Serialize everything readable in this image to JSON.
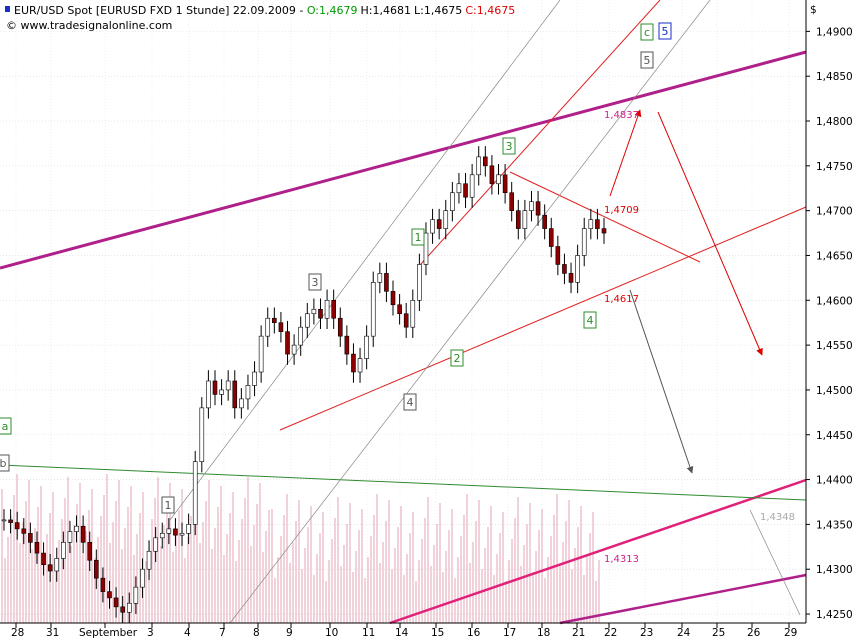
{
  "header": {
    "title": "EUR/USD Spot [EURUSD FXD  1 Stunde] 22.09.2009 - ",
    "open": "O:1,4679",
    "high": "H:1,4681",
    "low": "L:1,4675",
    "close": "C:1,4675",
    "source": "www.tradesignalonline.com",
    "currency_symbol": "$"
  },
  "colors": {
    "up_open": "#00aa00",
    "close_red": "#e00000",
    "candle": "#000000",
    "candle_body_down": "#8b0000",
    "magenta_channel": "#b0208a",
    "pink_channel": "#e0207a",
    "red_channel": "#e02020",
    "green_line": "#2e8b2e",
    "gray_line": "#888888",
    "arrow_red": "#e00000",
    "arrow_gray": "#555555",
    "wave_green": "#2e8b2e",
    "wave_gray": "#555555",
    "wave_blue": "#1a2ec8",
    "volume": "#e8b4c0"
  },
  "chart_data": {
    "type": "candlestick",
    "y_axis": {
      "min": 1.424,
      "max": 1.4935,
      "ticks": [
        "1,4250",
        "1,4300",
        "1,4350",
        "1,4400",
        "1,4450",
        "1,4500",
        "1,4550",
        "1,4600",
        "1,4650",
        "1,4700",
        "1,4750",
        "1,4800",
        "1,4850",
        "1,4900"
      ]
    },
    "x_axis": {
      "ticks": [
        "28",
        "31",
        "September",
        "3",
        "4",
        "7",
        "8",
        "9",
        "10",
        "11",
        "14",
        "15",
        "16",
        "17",
        "18",
        "21",
        "22",
        "23",
        "24",
        "25",
        "26",
        "29"
      ]
    },
    "price_labels": [
      {
        "text": "1,4837",
        "value": 1.4837,
        "color": "#d0208a"
      },
      {
        "text": "1,4709",
        "value": 1.4709,
        "color": "#e00000"
      },
      {
        "text": "1,4617",
        "value": 1.4617,
        "color": "#e00000"
      },
      {
        "text": "1,4348",
        "value": 1.4348,
        "color": "#aaaaaa"
      },
      {
        "text": "1,4313",
        "value": 1.4313,
        "color": "#d0208a"
      }
    ],
    "wave_labels": {
      "green": [
        "1",
        "2",
        "3",
        "4",
        "c",
        "a"
      ],
      "gray": [
        "1",
        "3",
        "4",
        "5",
        "b"
      ],
      "blue": [
        "5"
      ]
    },
    "close_series": [
      1.4355,
      1.4352,
      1.4345,
      1.434,
      1.433,
      1.4318,
      1.4305,
      1.4298,
      1.4312,
      1.433,
      1.4342,
      1.4348,
      1.433,
      1.431,
      1.429,
      1.4275,
      1.4268,
      1.4258,
      1.4252,
      1.4262,
      1.428,
      1.43,
      1.432,
      1.4335,
      1.434,
      1.4345,
      1.4338,
      1.434,
      1.435,
      1.442,
      1.448,
      1.451,
      1.4495,
      1.45,
      1.451,
      1.448,
      1.449,
      1.4505,
      1.452,
      1.456,
      1.458,
      1.4575,
      1.4565,
      1.454,
      1.455,
      1.457,
      1.4585,
      1.459,
      1.458,
      1.46,
      1.458,
      1.456,
      1.454,
      1.452,
      1.4535,
      1.456,
      1.462,
      1.463,
      1.461,
      1.4595,
      1.4585,
      1.457,
      1.46,
      1.464,
      1.4675,
      1.469,
      1.468,
      1.47,
      1.472,
      1.473,
      1.4715,
      1.474,
      1.476,
      1.475,
      1.473,
      1.474,
      1.472,
      1.47,
      1.468,
      1.47,
      1.471,
      1.4695,
      1.468,
      1.466,
      1.464,
      1.463,
      1.462,
      1.465,
      1.468,
      1.469,
      1.468,
      1.4675
    ]
  }
}
